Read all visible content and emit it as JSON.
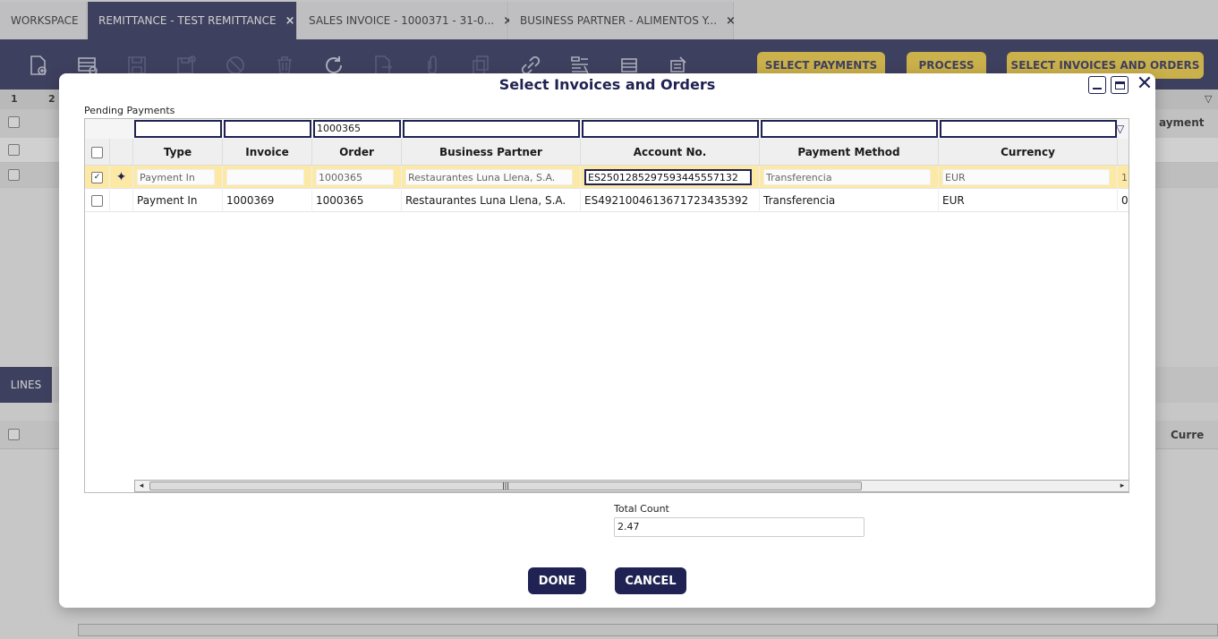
{
  "tabs": [
    {
      "label": "WORKSPACE",
      "closable": false,
      "active": false
    },
    {
      "label": "REMITTANCE - TEST REMITTANCE",
      "closable": true,
      "active": true
    },
    {
      "label": "SALES INVOICE - 1000371 - 31-0...",
      "closable": true,
      "active": false
    },
    {
      "label": "BUSINESS PARTNER - ALIMENTOS Y...",
      "closable": true,
      "active": false
    }
  ],
  "tab_close_glyph": "×",
  "toolbar": {
    "select_payments": "SELECT PAYMENTS",
    "process": "PROCESS",
    "select_invoices_orders": "SELECT INVOICES AND ORDERS"
  },
  "background": {
    "col1": "1",
    "col2": "2",
    "payment_header": "ayment",
    "lines_tab": "LINES",
    "currency_header": "Curre"
  },
  "dialog": {
    "title": "Select Invoices and Orders",
    "pending_label": "Pending Payments",
    "order_filter": "1000365",
    "columns": [
      "Type",
      "Invoice",
      "Order",
      "Business Partner",
      "Account No.",
      "Payment Method",
      "Currency"
    ],
    "rows": [
      {
        "selected": true,
        "pinned": true,
        "type": "Payment In",
        "invoice": "",
        "order": "1000365",
        "business_partner": "Restaurantes Luna Llena, S.A.",
        "account": "ES2501285297593445557132",
        "payment_method": "Transferencia",
        "currency": "EUR",
        "extra": "1"
      },
      {
        "selected": false,
        "pinned": false,
        "type": "Payment In",
        "invoice": "1000369",
        "order": "1000365",
        "business_partner": "Restaurantes Luna Llena, S.A.",
        "account": "ES4921004613671723435392",
        "payment_method": "Transferencia",
        "currency": "EUR",
        "extra": "0"
      }
    ],
    "total_count_label": "Total Count",
    "total_count_value": "2.47",
    "done": "DONE",
    "cancel": "CANCEL"
  },
  "colors": {
    "navy": "#1f2252",
    "yellow": "#f7cf33",
    "selected_row": "#fde9a6"
  }
}
